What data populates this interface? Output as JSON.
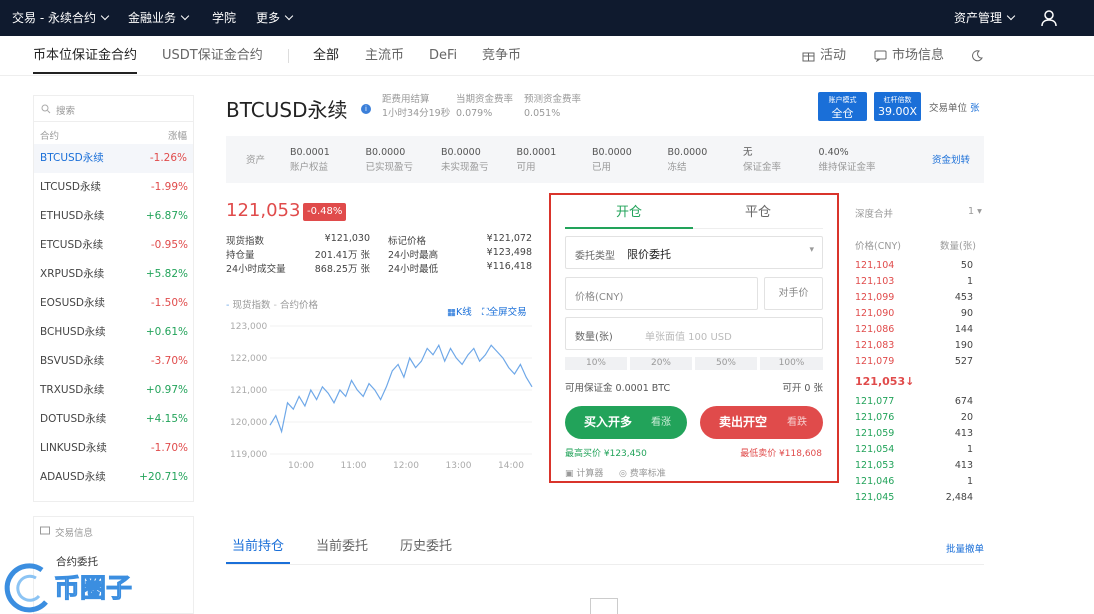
{
  "topnav": {
    "items": [
      "交易 - 永续合约",
      "金融业务",
      "学院",
      "更多"
    ],
    "asset_mgmt": "资产管理"
  },
  "subnav": {
    "left_tabs": [
      "币本位保证金合约",
      "USDT保证金合约"
    ],
    "market_tabs": [
      "全部",
      "主流币",
      "DeFi",
      "竞争币"
    ],
    "activity": "活动",
    "market_info": "市场信息"
  },
  "sidebar": {
    "search_placeholder": "搜索",
    "col_contract": "合约",
    "col_change": "涨幅",
    "items": [
      {
        "name": "BTCUSD永续",
        "change": "-1.26%",
        "dir": "down"
      },
      {
        "name": "LTCUSD永续",
        "change": "-1.99%",
        "dir": "down"
      },
      {
        "name": "ETHUSD永续",
        "change": "+6.87%",
        "dir": "up"
      },
      {
        "name": "ETCUSD永续",
        "change": "-0.95%",
        "dir": "down"
      },
      {
        "name": "XRPUSD永续",
        "change": "+5.82%",
        "dir": "up"
      },
      {
        "name": "EOSUSD永续",
        "change": "-1.50%",
        "dir": "down"
      },
      {
        "name": "BCHUSD永续",
        "change": "+0.61%",
        "dir": "up"
      },
      {
        "name": "BSVUSD永续",
        "change": "-3.70%",
        "dir": "down"
      },
      {
        "name": "TRXUSD永续",
        "change": "+0.97%",
        "dir": "up"
      },
      {
        "name": "DOTUSD永续",
        "change": "+4.15%",
        "dir": "up"
      },
      {
        "name": "LINKUSD永续",
        "change": "-1.70%",
        "dir": "down"
      },
      {
        "name": "ADAUSD永续",
        "change": "+20.71%",
        "dir": "up"
      }
    ],
    "info_title": "交易信息",
    "info_item": "合约委托"
  },
  "header": {
    "symbol": "BTCUSD永续",
    "funding_label": "距费用结算",
    "funding_time": "1小时34分19秒",
    "cur_rate_label": "当期资金费率",
    "cur_rate": "0.079%",
    "pred_rate_label": "预测资金费率",
    "pred_rate": "0.051%",
    "mode_title": "账户模式",
    "mode_value": "全仓",
    "lev_title": "杠杆倍数",
    "lev_value": "39.00X",
    "unit_label": "交易单位",
    "unit_value": "张"
  },
  "assets": {
    "label": "资产",
    "transfer": "资金划转",
    "items": [
      {
        "v": "B0.0001",
        "l": "账户权益"
      },
      {
        "v": "B0.0000",
        "l": "已实现盈亏"
      },
      {
        "v": "B0.0000",
        "l": "未实现盈亏"
      },
      {
        "v": "B0.0001",
        "l": "可用"
      },
      {
        "v": "B0.0000",
        "l": "已用"
      },
      {
        "v": "B0.0000",
        "l": "冻结"
      },
      {
        "v": "无",
        "l": "保证金率"
      },
      {
        "v": "0.40%",
        "l": "维持保证金率"
      }
    ]
  },
  "ticker": {
    "price": "121,053",
    "change": "-0.48%",
    "stats": [
      {
        "l": "现货指数",
        "v": "¥121,030",
        "l2": "标记价格",
        "v2": "¥121,072"
      },
      {
        "l": "持仓量",
        "v": "201.41万 张",
        "l2": "24小时最高",
        "v2": "¥123,498"
      },
      {
        "l": "24小时成交量",
        "v": "868.25万 张",
        "l2": "24小时最低",
        "v2": "¥116,418"
      }
    ]
  },
  "chart_legend": {
    "spot": "现货指数",
    "contract": "合约价格",
    "kline": "K线",
    "fullscreen": "全屏交易"
  },
  "chart_data": {
    "type": "line",
    "x_ticks": [
      "10:00",
      "11:00",
      "12:00",
      "13:00",
      "14:00"
    ],
    "y_ticks": [
      "123,000",
      "122,000",
      "121,000",
      "120,000",
      "119,000"
    ],
    "ylim": [
      119000,
      123000
    ],
    "values": [
      119900,
      120200,
      119700,
      120600,
      120400,
      120800,
      120500,
      121000,
      120700,
      121100,
      120900,
      120600,
      121000,
      120800,
      121300,
      121000,
      120800,
      121200,
      121000,
      120700,
      121100,
      121600,
      121800,
      121400,
      122000,
      121700,
      121900,
      122300,
      122100,
      122400,
      121900,
      122300,
      122000,
      121800,
      122100,
      122300,
      121900,
      122100,
      122400,
      122200,
      122000,
      121700,
      121500,
      121800,
      121400,
      121100
    ]
  },
  "order": {
    "tab_open": "开仓",
    "tab_close": "平仓",
    "type_label": "委托类型",
    "type_value": "限价委托",
    "price_placeholder": "价格(CNY)",
    "counter": "对手价",
    "qty_label": "数量(张)",
    "qty_placeholder": "单张面值 100 USD",
    "percents": [
      "10%",
      "20%",
      "50%",
      "100%"
    ],
    "avail_label": "可用保证金 0.0001 BTC",
    "open_avail": "可开 0 张",
    "buy_btn": "买入开多",
    "buy_sub": "看涨",
    "sell_btn": "卖出开空",
    "sell_sub": "看跌",
    "max_buy": "最高买价 ¥123,450",
    "min_sell": "最低卖价 ¥118,608",
    "calc": "计算器",
    "fee": "费率标准"
  },
  "depth": {
    "title": "深度合并",
    "merge": "1",
    "col_price": "价格(CNY)",
    "col_qty": "数量(张)",
    "asks": [
      {
        "p": "121,104",
        "q": "50"
      },
      {
        "p": "121,103",
        "q": "1"
      },
      {
        "p": "121,099",
        "q": "453"
      },
      {
        "p": "121,090",
        "q": "90"
      },
      {
        "p": "121,086",
        "q": "144"
      },
      {
        "p": "121,083",
        "q": "190"
      },
      {
        "p": "121,079",
        "q": "527"
      }
    ],
    "last": "121,053↓",
    "bids": [
      {
        "p": "121,077",
        "q": "674"
      },
      {
        "p": "121,076",
        "q": "20"
      },
      {
        "p": "121,059",
        "q": "413"
      },
      {
        "p": "121,054",
        "q": "1"
      },
      {
        "p": "121,053",
        "q": "413"
      },
      {
        "p": "121,046",
        "q": "1"
      },
      {
        "p": "121,045",
        "q": "2,484"
      }
    ]
  },
  "bottom_tabs": {
    "tabs": [
      "当前持仓",
      "当前委托",
      "历史委托"
    ],
    "batch_cancel": "批量撤单"
  },
  "watermark": "币圈子",
  "colors": {
    "topbar": "#0f1a2e",
    "green": "#22a35a",
    "red": "#e04b4b",
    "accent": "#1a6fd8"
  }
}
